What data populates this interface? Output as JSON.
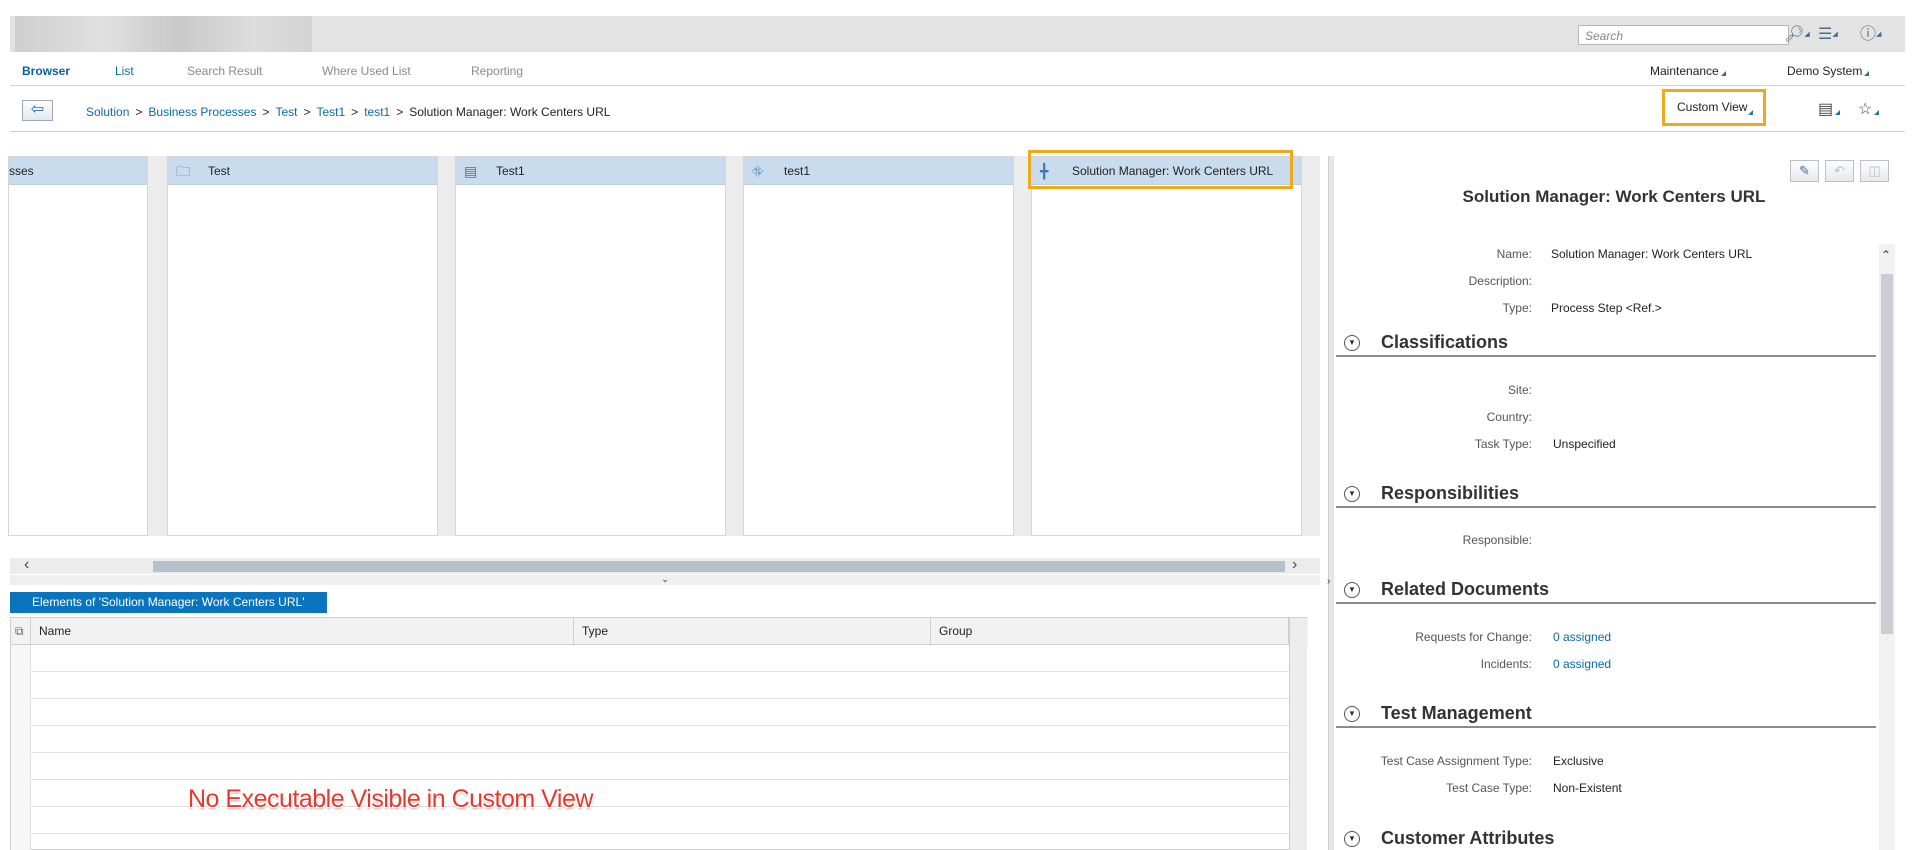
{
  "shell": {
    "search_placeholder": "Search",
    "icons": [
      "binoculars-icon",
      "list-menu-icon",
      "help-icon"
    ]
  },
  "nav": {
    "items": [
      "Browser",
      "List",
      "Search Result",
      "Where Used List",
      "Reporting"
    ],
    "right_menus": [
      "Maintenance",
      "Demo System"
    ]
  },
  "breadcrumb": {
    "items": [
      "Solution",
      "Business Processes",
      "Test",
      "Test1",
      "test1"
    ],
    "separator": ">",
    "current": "Solution Manager: Work Centers URL",
    "custom_view_label": "Custom View"
  },
  "columns": [
    {
      "title": "sses",
      "icon": "folder-icon"
    },
    {
      "title": "Test",
      "icon": "folder-icon"
    },
    {
      "title": "Test1",
      "icon": "scenario-icon"
    },
    {
      "title": "test1",
      "icon": "process-icon"
    },
    {
      "title": "Solution Manager: Work Centers URL",
      "icon": "process-step-icon"
    }
  ],
  "elements": {
    "tab_label": "Elements of 'Solution Manager: Work Centers URL'",
    "headers": [
      "Name",
      "Type",
      "Group"
    ]
  },
  "overlay_note": "No Executable Visible in Custom View",
  "detail": {
    "title": "Solution Manager: Work Centers URL",
    "name_label": "Name:",
    "name_value": "Solution Manager: Work Centers URL",
    "description_label": "Description:",
    "description_value": "",
    "type_label": "Type:",
    "type_value": "Process Step <Ref.>",
    "sections": {
      "classifications": {
        "title": "Classifications",
        "site_label": "Site:",
        "country_label": "Country:",
        "task_type_label": "Task Type:",
        "task_type_value": "Unspecified"
      },
      "responsibilities": {
        "title": "Responsibilities",
        "responsible_label": "Responsible:"
      },
      "related_documents": {
        "title": "Related Documents",
        "requests_label": "Requests for Change:",
        "requests_value": "0 assigned",
        "incidents_label": "Incidents:",
        "incidents_value": "0 assigned"
      },
      "test_management": {
        "title": "Test Management",
        "assign_label": "Test Case Assignment Type:",
        "assign_value": "Exclusive",
        "case_type_label": "Test Case Type:",
        "case_type_value": "Non-Existent"
      },
      "customer_attributes": {
        "title": "Customer Attributes"
      }
    }
  },
  "colors": {
    "accent": "#0a74bf",
    "highlight": "#f0a81c",
    "column_header": "#c8dced",
    "note": "#e23a2e"
  }
}
